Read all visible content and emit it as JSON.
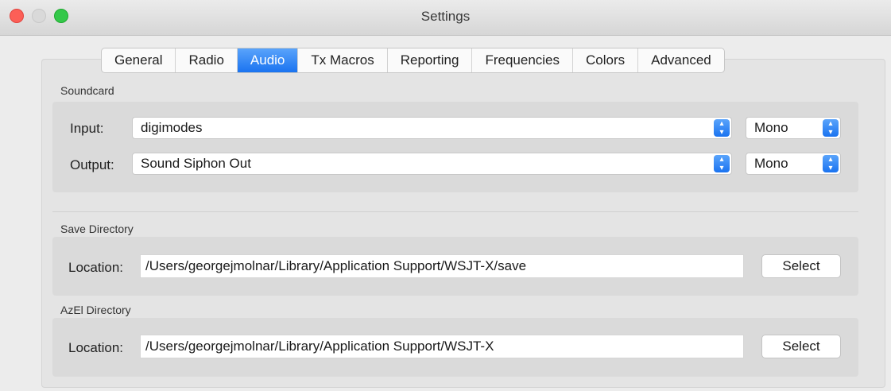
{
  "window": {
    "title": "Settings"
  },
  "tabs": [
    {
      "label": "General",
      "active": false
    },
    {
      "label": "Radio",
      "active": false
    },
    {
      "label": "Audio",
      "active": true
    },
    {
      "label": "Tx Macros",
      "active": false
    },
    {
      "label": "Reporting",
      "active": false
    },
    {
      "label": "Frequencies",
      "active": false
    },
    {
      "label": "Colors",
      "active": false
    },
    {
      "label": "Advanced",
      "active": false
    }
  ],
  "soundcard": {
    "label": "Soundcard",
    "input_label": "Input:",
    "input_device": "digimodes",
    "input_channel": "Mono",
    "output_label": "Output:",
    "output_device": "Sound Siphon Out",
    "output_channel": "Mono"
  },
  "save_directory": {
    "label": "Save Directory",
    "location_label": "Location:",
    "path": "/Users/georgejmolnar/Library/Application Support/WSJT-X/save",
    "button": "Select"
  },
  "azel_directory": {
    "label": "AzEl Directory",
    "location_label": "Location:",
    "path": "/Users/georgejmolnar/Library/Application Support/WSJT-X",
    "button": "Select"
  },
  "colors": {
    "accent": "#1a73f0",
    "close": "#fc5f57",
    "zoom": "#34c84a"
  }
}
